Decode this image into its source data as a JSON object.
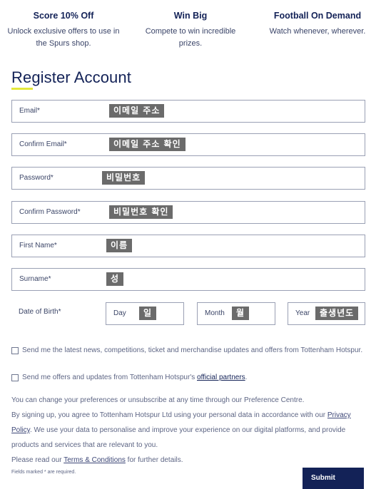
{
  "benefits": [
    {
      "title": "Score 10% Off",
      "desc": "Unlock exclusive offers to use in the Spurs shop.",
      "icon": "tag-icon"
    },
    {
      "title": "Win Big",
      "desc": "Compete to win incredible prizes.",
      "icon": "trophy-icon"
    },
    {
      "title": "Football On Demand",
      "desc": "Watch whenever, wherever.",
      "icon": "screen-icon"
    }
  ],
  "form": {
    "title": "Register Account",
    "accent_color": "#e4e83a",
    "fields": [
      {
        "label": "Email*",
        "annotation": "이메일 주소"
      },
      {
        "label": "Confirm Email*",
        "annotation": "이메일 주소 확인"
      },
      {
        "label": "Password*",
        "annotation": "비밀번호"
      },
      {
        "label": "Confirm Password*",
        "annotation": "비밀번호 확인"
      },
      {
        "label": "First Name*",
        "annotation": "이름"
      },
      {
        "label": "Surname*",
        "annotation": "성"
      }
    ],
    "dob": {
      "label": "Date of Birth*",
      "day": {
        "label": "Day",
        "annotation": "일"
      },
      "month": {
        "label": "Month",
        "annotation": "월"
      },
      "year": {
        "label": "Year",
        "annotation": "출생년도"
      }
    },
    "checkboxes": [
      {
        "text": "Send me the latest news, competitions, ticket and merchandise updates and offers from Tottenham Hotspur.",
        "checked": false
      },
      {
        "text_before": "Send me offers and updates from Tottenham Hotspur's ",
        "link": "official partners",
        "text_after": ".",
        "checked": false
      }
    ],
    "info": {
      "line1": "You can change your preferences or unsubscribe at any time through our Preference Centre.",
      "line2_before": "By signing up, you agree to Tottenham Hotspur Ltd using your personal data in accordance with our ",
      "line2_link": "Privacy",
      "line3_link": "Policy",
      "line3_after": ". We use your data to personalise and improve your experience on our digital platforms, and provide",
      "line4": "products and services that are relevant to you.",
      "line5_before": "Please read our ",
      "line5_link": "Terms & Conditions",
      "line5_after": " for further details."
    },
    "required_note": "Fields marked * are required.",
    "submit_label": "Submit",
    "brand_color": "#132257"
  }
}
